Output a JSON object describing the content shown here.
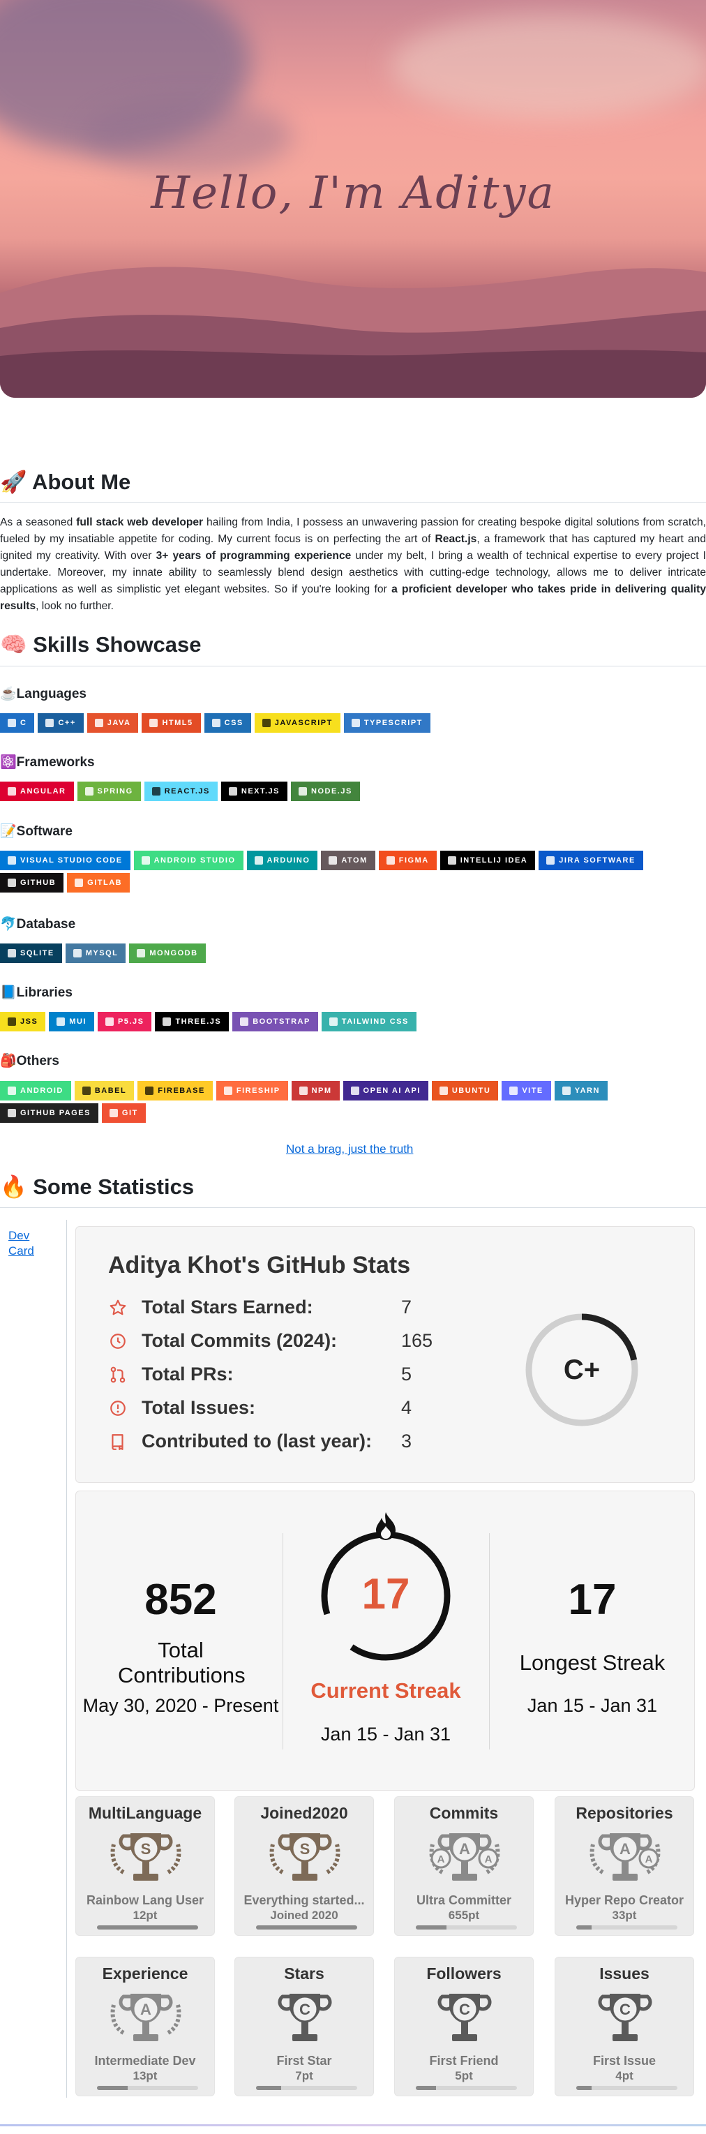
{
  "hero": {
    "title": "Hello, I'm Aditya"
  },
  "about": {
    "heading": "🚀 About Me",
    "p1": "As a seasoned ",
    "b1": "full stack web developer",
    "p2": " hailing from India, I possess an unwavering passion for creating bespoke digital solutions from scratch, fueled by my insatiable appetite for coding. My current focus is on perfecting the art of ",
    "b2": "React.js",
    "p3": ", a framework that has captured my heart and ignited my creativity. With over ",
    "b3": "3+ years of programming experience",
    "p4": " under my belt, I bring a wealth of technical expertise to every project I undertake. Moreover, my innate ability to seamlessly blend design aesthetics with cutting-edge technology, allows me to deliver intricate applications as well as simplistic yet elegant websites. So if you're looking for ",
    "b4": "a proficient developer who takes pride in delivering quality results",
    "p5": ", look no further."
  },
  "skills": {
    "heading": "🧠 Skills Showcase",
    "categories": [
      {
        "title": "☕Languages",
        "badges": [
          {
            "label": "C",
            "color": "#1f6fc5"
          },
          {
            "label": "C++",
            "color": "#1a5f9e"
          },
          {
            "label": "JAVA",
            "color": "#e5532d"
          },
          {
            "label": "HTML5",
            "color": "#e34c26"
          },
          {
            "label": "CSS",
            "color": "#1f6fb5"
          },
          {
            "label": "JAVASCRIPT",
            "color": "#f7df1e",
            "dark": true
          },
          {
            "label": "TYPESCRIPT",
            "color": "#3178c6"
          }
        ]
      },
      {
        "title": "⚛️Frameworks",
        "badges": [
          {
            "label": "ANGULAR",
            "color": "#dd0031"
          },
          {
            "label": "SPRING",
            "color": "#6db33f"
          },
          {
            "label": "REACT.JS",
            "color": "#61dafb",
            "dark": true
          },
          {
            "label": "NEXT.JS",
            "color": "#000000"
          },
          {
            "label": "NODE.JS",
            "color": "#43853d"
          }
        ]
      },
      {
        "title": "📝Software",
        "badges": [
          {
            "label": "VISUAL STUDIO CODE",
            "color": "#0078d7"
          },
          {
            "label": "ANDROID STUDIO",
            "color": "#3ddc84"
          },
          {
            "label": "ARDUINO",
            "color": "#00979d"
          },
          {
            "label": "ATOM",
            "color": "#66595c"
          },
          {
            "label": "FIGMA",
            "color": "#f24e1e"
          },
          {
            "label": "INTELLIJ IDEA",
            "color": "#000000"
          },
          {
            "label": "JIRA SOFTWARE",
            "color": "#0a58ca"
          },
          {
            "label": "GITHUB",
            "color": "#121011"
          },
          {
            "label": "GITLAB",
            "color": "#fc6d26"
          }
        ]
      },
      {
        "title": "🐬Database",
        "badges": [
          {
            "label": "SQLITE",
            "color": "#07405e"
          },
          {
            "label": "MYSQL",
            "color": "#4479a1"
          },
          {
            "label": "MONGODB",
            "color": "#4ea94b"
          }
        ]
      },
      {
        "title": "📘Libraries",
        "badges": [
          {
            "label": "JSS",
            "color": "#f7df1e",
            "dark": true
          },
          {
            "label": "MUI",
            "color": "#0081cb"
          },
          {
            "label": "P5.JS",
            "color": "#ed225d"
          },
          {
            "label": "THREE.JS",
            "color": "#000000"
          },
          {
            "label": "BOOTSTRAP",
            "color": "#7952b3"
          },
          {
            "label": "TAILWIND CSS",
            "color": "#38b2ac"
          }
        ]
      },
      {
        "title": "🎒Others",
        "badges": [
          {
            "label": "ANDROID",
            "color": "#3ddc84"
          },
          {
            "label": "BABEL",
            "color": "#f9dc3e",
            "dark": true
          },
          {
            "label": "FIREBASE",
            "color": "#ffca28",
            "dark": true
          },
          {
            "label": "FIRESHIP",
            "color": "#ff6d3f"
          },
          {
            "label": "NPM",
            "color": "#cb3837"
          },
          {
            "label": "OPEN AI API",
            "color": "#412991"
          },
          {
            "label": "UBUNTU",
            "color": "#e95420"
          },
          {
            "label": "VITE",
            "color": "#646cff"
          },
          {
            "label": "YARN",
            "color": "#2c8ebb"
          },
          {
            "label": "GITHUB PAGES",
            "color": "#222222"
          },
          {
            "label": "GIT",
            "color": "#f05033"
          }
        ]
      }
    ],
    "brag_link": "Not a brag, just the truth"
  },
  "statistics": {
    "heading": "🔥 Some Statistics",
    "dev_card_alt": "Dev Card",
    "github_stats": {
      "title": "Aditya Khot's GitHub Stats",
      "rows": [
        {
          "label": "Total Stars Earned:",
          "value": "7",
          "icon": "star-icon"
        },
        {
          "label": "Total Commits (2024):",
          "value": "165",
          "icon": "clock-icon"
        },
        {
          "label": "Total PRs:",
          "value": "5",
          "icon": "pull-request-icon"
        },
        {
          "label": "Total Issues:",
          "value": "4",
          "icon": "issue-icon"
        },
        {
          "label": "Contributed to (last year):",
          "value": "3",
          "icon": "repo-icon"
        }
      ],
      "grade": "C+",
      "grade_progress": 0.22
    },
    "streak": {
      "total_value": "852",
      "total_label": "Total Contributions",
      "total_range": "May 30, 2020 - Present",
      "current_value": "17",
      "current_label": "Current Streak",
      "current_range": "Jan 15 - Jan 31",
      "longest_value": "17",
      "longest_label": "Longest Streak",
      "longest_range": "Jan 15 - Jan 31",
      "accent": "#e05a3a"
    },
    "trophies": [
      {
        "title": "MultiLanguage",
        "grade": "S",
        "name": "Rainbow Lang User",
        "points": "12pt",
        "progress": 1.0,
        "color": "#7d6a57"
      },
      {
        "title": "Joined2020",
        "grade": "S",
        "name": "Everything started...",
        "points": "Joined 2020",
        "progress": 1.0,
        "color": "#7d6a57"
      },
      {
        "title": "Commits",
        "grade": "A",
        "name": "Ultra Committer",
        "points": "655pt",
        "progress": 0.3,
        "color": "#8a8a8a"
      },
      {
        "title": "Repositories",
        "grade": "A",
        "name": "Hyper Repo Creator",
        "points": "33pt",
        "progress": 0.15,
        "color": "#8a8a8a"
      },
      {
        "title": "Experience",
        "grade": "A",
        "name": "Intermediate Dev",
        "points": "13pt",
        "progress": 0.3,
        "color": "#8a8a8a"
      },
      {
        "title": "Stars",
        "grade": "C",
        "name": "First Star",
        "points": "7pt",
        "progress": 0.25,
        "color": "#5a5a5a"
      },
      {
        "title": "Followers",
        "grade": "C",
        "name": "First Friend",
        "points": "5pt",
        "progress": 0.2,
        "color": "#5a5a5a"
      },
      {
        "title": "Issues",
        "grade": "C",
        "name": "First Issue",
        "points": "4pt",
        "progress": 0.15,
        "color": "#5a5a5a"
      }
    ]
  }
}
